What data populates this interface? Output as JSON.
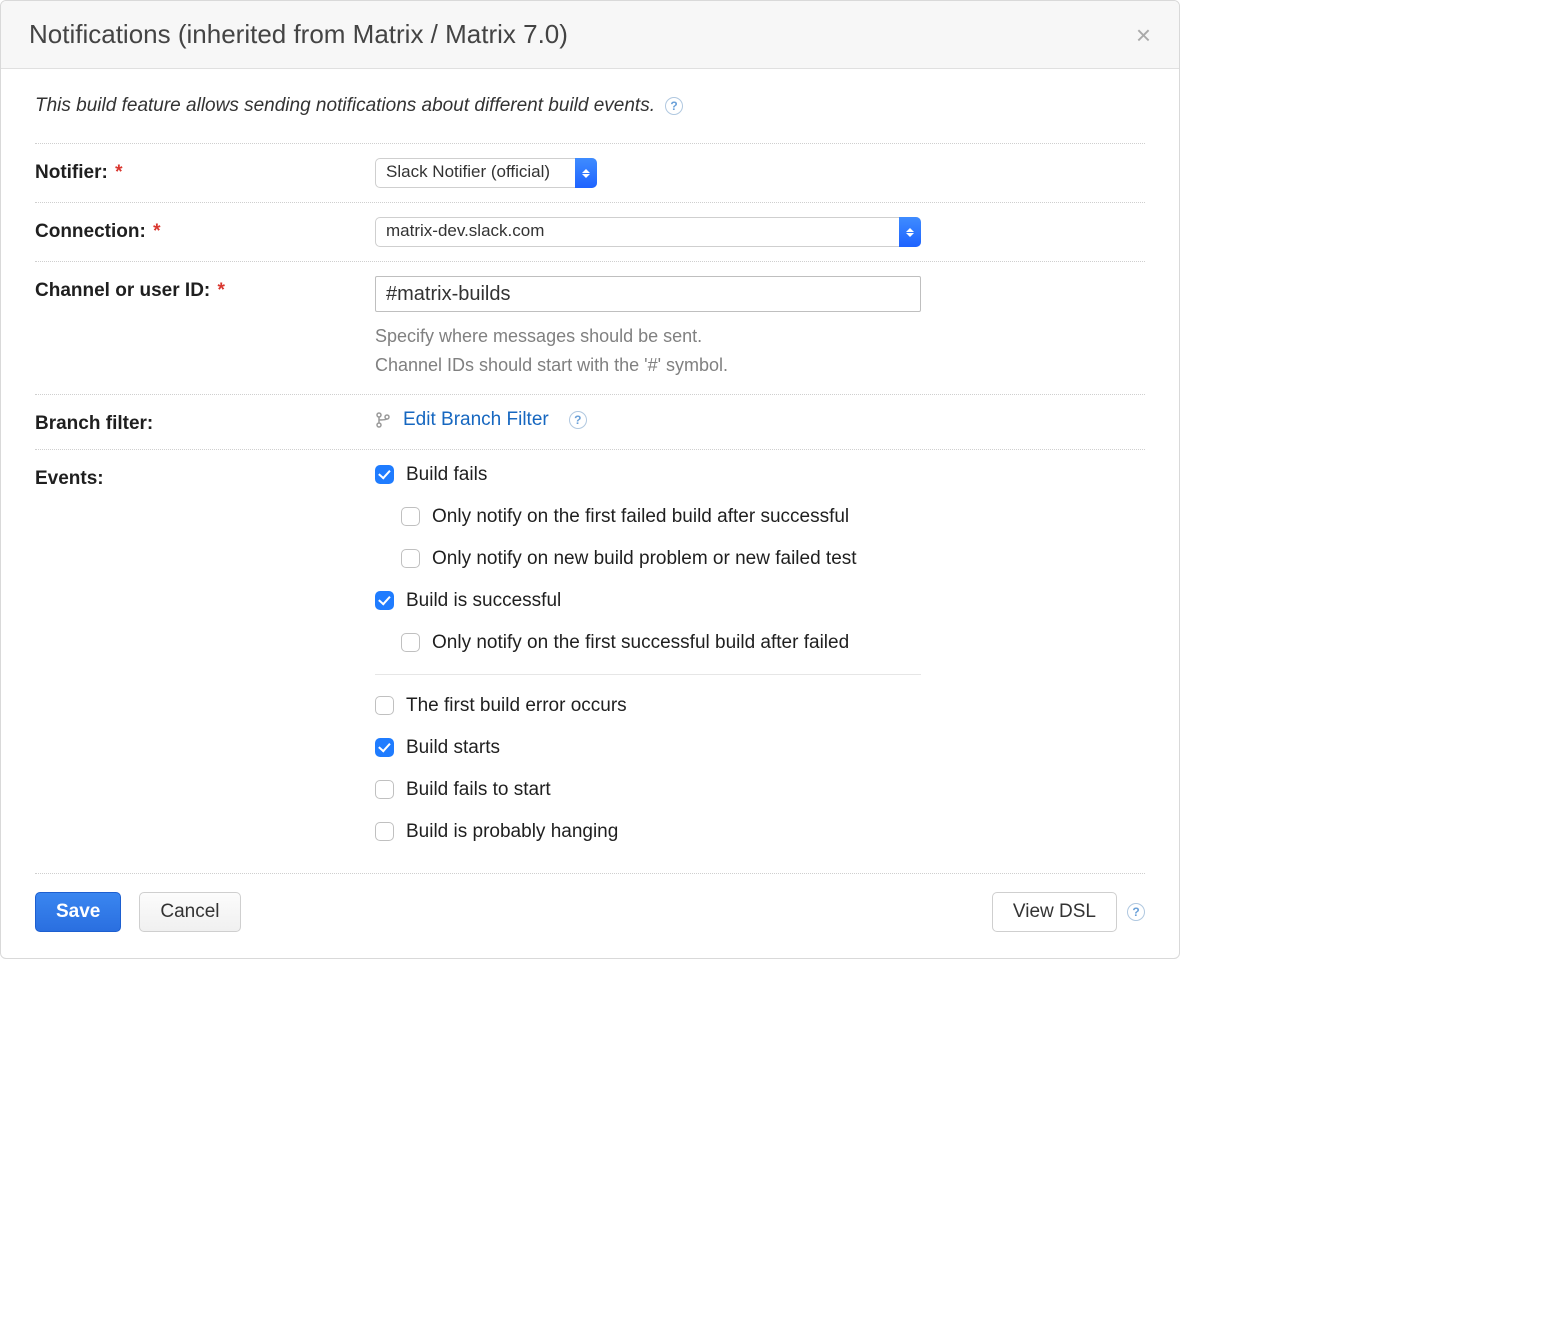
{
  "header": {
    "title": "Notifications (inherited from Matrix / Matrix 7.0)"
  },
  "intro": {
    "text": "This build feature allows sending notifications about different build events."
  },
  "labels": {
    "notifier": "Notifier:",
    "connection": "Connection:",
    "channel": "Channel or user ID:",
    "branch_filter": "Branch filter:",
    "events": "Events:"
  },
  "fields": {
    "notifier_value": "Slack Notifier (official)",
    "connection_value": "matrix-dev.slack.com",
    "channel_value": "#matrix-builds",
    "channel_hint_1": "Specify where messages should be sent.",
    "channel_hint_2": "Channel IDs should start with the '#' symbol.",
    "branch_filter_link": "Edit Branch Filter"
  },
  "events": {
    "build_fails": "Build fails",
    "only_first_failed": "Only notify on the first failed build after successful",
    "only_new_problem": "Only notify on new build problem or new failed test",
    "build_successful": "Build is successful",
    "only_first_success": "Only notify on the first successful build after failed",
    "first_build_error": "The first build error occurs",
    "build_starts": "Build starts",
    "build_fails_to_start": "Build fails to start",
    "build_hanging": "Build is probably hanging"
  },
  "footer": {
    "save": "Save",
    "cancel": "Cancel",
    "view_dsl": "View DSL"
  }
}
